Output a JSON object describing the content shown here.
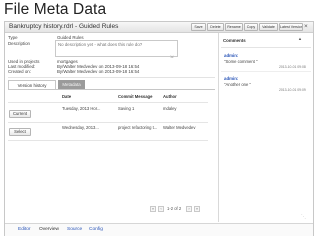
{
  "slide_title": "File Meta Data",
  "header": {
    "doc_title": "Bankruptcy history.rdrl - Guided Rules",
    "buttons": [
      "Save",
      "Delete",
      "Rename",
      "Copy",
      "Validate",
      "Latest Version"
    ],
    "latest_dropdown_icon": "chevron-down-icon",
    "close_icon": "close-icon"
  },
  "meta": {
    "type_label": "Type",
    "type_value": "Guided Rules",
    "description_label": "Description",
    "description_placeholder": "No description yet - what does this rule do?",
    "used_in_label": "Used in projects",
    "used_in_value": "mortgages",
    "last_modified_label": "Last modified:",
    "last_modified_value": "By/Walter Medvedev on 2013-09-18 16:54",
    "created_on_label": "Created on:",
    "created_on_value": "By/Walter Medvedev on 2013-09-18 16:54"
  },
  "tabs": {
    "active": "Version history",
    "inactive": "Metadata"
  },
  "history": {
    "columns": [
      "Date",
      "Commit Message",
      "Author"
    ],
    "rows": [
      {
        "button": "Current",
        "date": "Tuesday, 2013 Hor...",
        "message": "Saving 1",
        "author": "mdaley"
      },
      {
        "button": "Select",
        "date": "Wednesday, 2013...",
        "message": "project refactoring t...",
        "author": "Walter Medvedev"
      }
    ]
  },
  "pager": {
    "range": "1-2 of 2",
    "first_icon": "first-page-icon",
    "prev_icon": "prev-page-icon",
    "next_icon": "next-page-icon",
    "last_icon": "last-page-icon"
  },
  "comments": {
    "heading": "Comments",
    "items": [
      {
        "author": "admin:",
        "text": "\"Some comment \"",
        "time": "2013-10-01 09:08"
      },
      {
        "author": "admin:",
        "text": "\"Another one \"",
        "time": "2013-10-01 09:09"
      }
    ]
  },
  "footer": {
    "tabs": [
      "Editor",
      "Overview",
      "Source",
      "Config"
    ],
    "active": "Overview"
  }
}
